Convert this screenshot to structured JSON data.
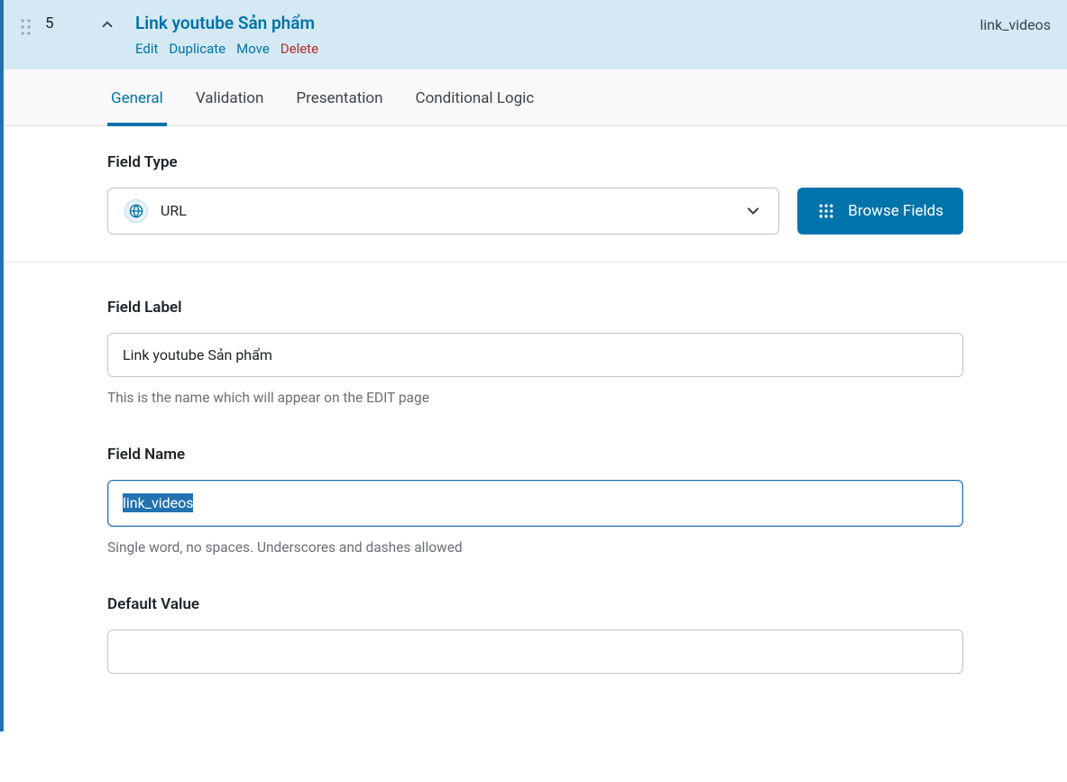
{
  "header": {
    "order": "5",
    "title": "Link youtube Sản phẩm",
    "key": "link_videos",
    "actions": {
      "edit": "Edit",
      "duplicate": "Duplicate",
      "move": "Move",
      "delete": "Delete"
    }
  },
  "tabs": {
    "general": "General",
    "validation": "Validation",
    "presentation": "Presentation",
    "conditional": "Conditional Logic"
  },
  "field_type": {
    "label": "Field Type",
    "value": "URL",
    "browse_label": "Browse Fields"
  },
  "field_label": {
    "label": "Field Label",
    "value": "Link youtube Sản phẩm",
    "desc": "This is the name which will appear on the EDIT page"
  },
  "field_name": {
    "label": "Field Name",
    "value": "link_videos",
    "desc": "Single word, no spaces. Underscores and dashes allowed"
  },
  "default_value": {
    "label": "Default Value",
    "value": ""
  }
}
